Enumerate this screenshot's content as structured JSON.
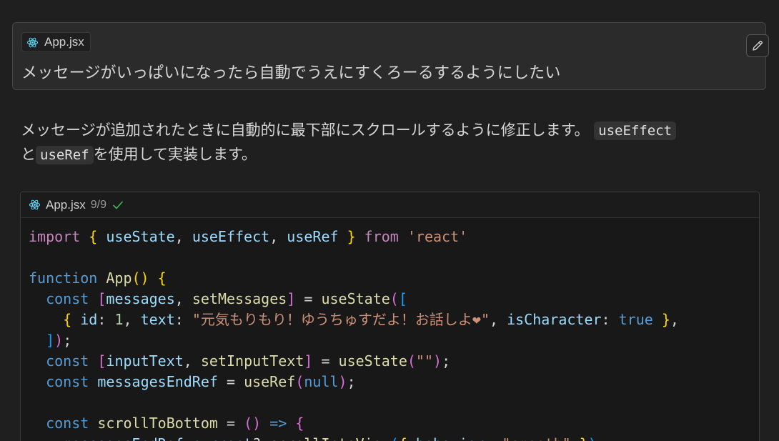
{
  "prompt": {
    "file_chip_label": "App.jsx",
    "text": "メッセージがいっぱいになったら自動でうえにすくろーるするようにしたい"
  },
  "response": {
    "text_1": "メッセージが追加されたときに自動的に最下部にスクロールするように修正します。",
    "code_1": "useEffect",
    "text_2": "と",
    "code_2": "useRef",
    "text_3": "を使用して実装します。"
  },
  "code_block": {
    "filename": "App.jsx",
    "counter": "9/9",
    "lines": [
      [
        [
          "kw",
          "import"
        ],
        [
          "pl",
          " "
        ],
        [
          "brace",
          "{"
        ],
        [
          "pl",
          " "
        ],
        [
          "id",
          "useState"
        ],
        [
          "pl",
          ", "
        ],
        [
          "id",
          "useEffect"
        ],
        [
          "pl",
          ", "
        ],
        [
          "id",
          "useRef"
        ],
        [
          "pl",
          " "
        ],
        [
          "brace",
          "}"
        ],
        [
          "pl",
          " "
        ],
        [
          "kw",
          "from"
        ],
        [
          "pl",
          " "
        ],
        [
          "str",
          "'react'"
        ]
      ],
      [],
      [
        [
          "kw2",
          "function"
        ],
        [
          "pl",
          " "
        ],
        [
          "fn",
          "App"
        ],
        [
          "brace",
          "()"
        ],
        [
          "pl",
          " "
        ],
        [
          "brace",
          "{"
        ]
      ],
      [
        [
          "pl",
          "  "
        ],
        [
          "kw2",
          "const"
        ],
        [
          "pl",
          " "
        ],
        [
          "br2",
          "["
        ],
        [
          "id",
          "messages"
        ],
        [
          "pl",
          ", "
        ],
        [
          "fn",
          "setMessages"
        ],
        [
          "br2",
          "]"
        ],
        [
          "pl",
          " = "
        ],
        [
          "fn",
          "useState"
        ],
        [
          "br2",
          "("
        ],
        [
          "br3",
          "["
        ]
      ],
      [
        [
          "pl",
          "    "
        ],
        [
          "brace",
          "{"
        ],
        [
          "pl",
          " "
        ],
        [
          "id",
          "id"
        ],
        [
          "pl",
          ": "
        ],
        [
          "num",
          "1"
        ],
        [
          "pl",
          ", "
        ],
        [
          "id",
          "text"
        ],
        [
          "pl",
          ": "
        ],
        [
          "str",
          "\"元気もりもり！ゆうちゅすだよ！お話しよ❤\""
        ],
        [
          "pl",
          ", "
        ],
        [
          "id",
          "isCharacter"
        ],
        [
          "pl",
          ": "
        ],
        [
          "kw2",
          "true"
        ],
        [
          "pl",
          " "
        ],
        [
          "brace",
          "}"
        ],
        [
          "pl",
          ","
        ]
      ],
      [
        [
          "pl",
          "  "
        ],
        [
          "br3",
          "]"
        ],
        [
          "br2",
          ")"
        ],
        [
          "pl",
          ";"
        ]
      ],
      [
        [
          "pl",
          "  "
        ],
        [
          "kw2",
          "const"
        ],
        [
          "pl",
          " "
        ],
        [
          "br2",
          "["
        ],
        [
          "id",
          "inputText"
        ],
        [
          "pl",
          ", "
        ],
        [
          "fn",
          "setInputText"
        ],
        [
          "br2",
          "]"
        ],
        [
          "pl",
          " = "
        ],
        [
          "fn",
          "useState"
        ],
        [
          "br2",
          "("
        ],
        [
          "str",
          "\"\""
        ],
        [
          "br2",
          ")"
        ],
        [
          "pl",
          ";"
        ]
      ],
      [
        [
          "pl",
          "  "
        ],
        [
          "kw2",
          "const"
        ],
        [
          "pl",
          " "
        ],
        [
          "id",
          "messagesEndRef"
        ],
        [
          "pl",
          " = "
        ],
        [
          "fn",
          "useRef"
        ],
        [
          "br2",
          "("
        ],
        [
          "kw2",
          "null"
        ],
        [
          "br2",
          ")"
        ],
        [
          "pl",
          ";"
        ]
      ],
      [],
      [
        [
          "pl",
          "  "
        ],
        [
          "kw2",
          "const"
        ],
        [
          "pl",
          " "
        ],
        [
          "fn",
          "scrollToBottom"
        ],
        [
          "pl",
          " = "
        ],
        [
          "br2",
          "()"
        ],
        [
          "pl",
          " "
        ],
        [
          "kw2",
          "=>"
        ],
        [
          "pl",
          " "
        ],
        [
          "br2",
          "{"
        ]
      ],
      [
        [
          "pl",
          "    "
        ],
        [
          "id",
          "messagesEndRef"
        ],
        [
          "pl",
          "."
        ],
        [
          "id",
          "current"
        ],
        [
          "pl",
          "?."
        ],
        [
          "fn",
          "scrollIntoView"
        ],
        [
          "br3",
          "("
        ],
        [
          "brace",
          "{"
        ],
        [
          "pl",
          " "
        ],
        [
          "id",
          "behavior"
        ],
        [
          "pl",
          ": "
        ],
        [
          "str",
          "\"smooth\""
        ],
        [
          "pl",
          " "
        ],
        [
          "brace",
          "}"
        ],
        [
          "br3",
          ")"
        ],
        [
          "pl",
          ";"
        ]
      ]
    ]
  },
  "icons": {
    "file_icon": "react-icon",
    "edit_icon": "pencil-icon",
    "status_icon": "check-icon"
  },
  "colors": {
    "background": "#1f1f1f",
    "card": "#2b2b2b",
    "react_blue": "#61dafb",
    "check_green": "#3fb950"
  }
}
